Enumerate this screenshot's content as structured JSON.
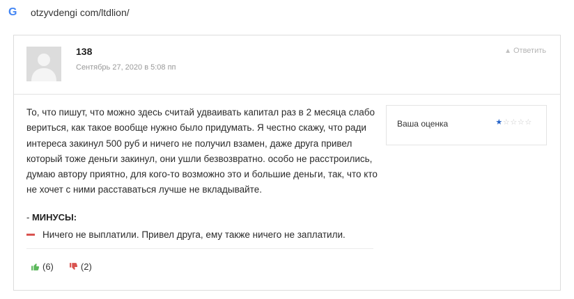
{
  "browser": {
    "logo_letter": "G",
    "url": "otzyvdengi com/ltdlion/"
  },
  "review": {
    "author": "138",
    "date": "Сентябрь 27, 2020 в 5:08 пп",
    "reply_label": "Ответить",
    "text": "То, что пишут, что можно здесь считай удваивать капитал раз в 2 месяца слабо вериться, как такое вообще нужно было придумать. Я честно скажу, что ради интереса закинул 500 руб и ничего не получил взамен, даже друга привел который тоже деньги закинул, они ушли безвозвратно. особо не расстроились, думаю автору приятно, для кого-то возможно это и большие деньги, так, что кто не хочет с ними расставаться лучше не вкладывайте.",
    "rating_label": "Ваша оценка",
    "rating_value": 1,
    "rating_max": 5,
    "minus_prefix": "- ",
    "minus_heading": "МИНУСЫ:",
    "minus_item": "Ничего не выплатили. Привел друга, ему также ничего не заплатили.",
    "likes": "(6)",
    "dislikes": "(2)"
  },
  "colors": {
    "like": "#5cb85c",
    "dislike": "#d9534f",
    "star_filled": "#2563c9"
  }
}
